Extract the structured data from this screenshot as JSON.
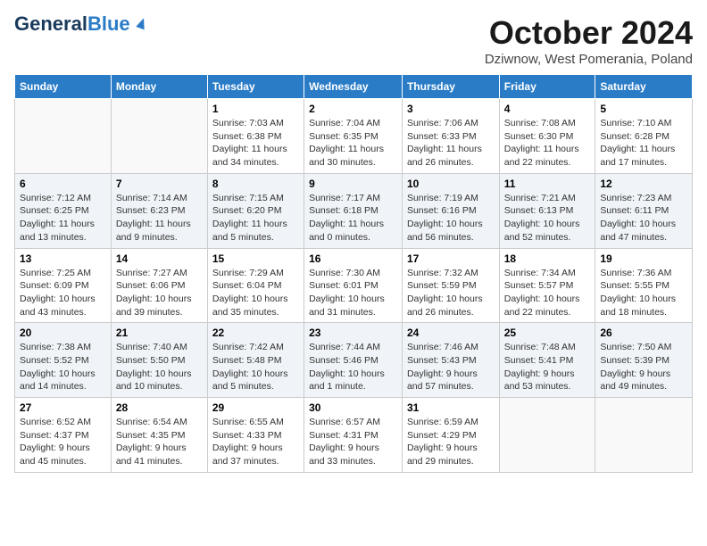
{
  "header": {
    "logo_general": "General",
    "logo_blue": "Blue",
    "month_title": "October 2024",
    "location": "Dziwnow, West Pomerania, Poland"
  },
  "days_of_week": [
    "Sunday",
    "Monday",
    "Tuesday",
    "Wednesday",
    "Thursday",
    "Friday",
    "Saturday"
  ],
  "weeks": [
    [
      {
        "day": "",
        "sunrise": "",
        "sunset": "",
        "daylight": ""
      },
      {
        "day": "",
        "sunrise": "",
        "sunset": "",
        "daylight": ""
      },
      {
        "day": "1",
        "sunrise": "Sunrise: 7:03 AM",
        "sunset": "Sunset: 6:38 PM",
        "daylight": "Daylight: 11 hours and 34 minutes."
      },
      {
        "day": "2",
        "sunrise": "Sunrise: 7:04 AM",
        "sunset": "Sunset: 6:35 PM",
        "daylight": "Daylight: 11 hours and 30 minutes."
      },
      {
        "day": "3",
        "sunrise": "Sunrise: 7:06 AM",
        "sunset": "Sunset: 6:33 PM",
        "daylight": "Daylight: 11 hours and 26 minutes."
      },
      {
        "day": "4",
        "sunrise": "Sunrise: 7:08 AM",
        "sunset": "Sunset: 6:30 PM",
        "daylight": "Daylight: 11 hours and 22 minutes."
      },
      {
        "day": "5",
        "sunrise": "Sunrise: 7:10 AM",
        "sunset": "Sunset: 6:28 PM",
        "daylight": "Daylight: 11 hours and 17 minutes."
      }
    ],
    [
      {
        "day": "6",
        "sunrise": "Sunrise: 7:12 AM",
        "sunset": "Sunset: 6:25 PM",
        "daylight": "Daylight: 11 hours and 13 minutes."
      },
      {
        "day": "7",
        "sunrise": "Sunrise: 7:14 AM",
        "sunset": "Sunset: 6:23 PM",
        "daylight": "Daylight: 11 hours and 9 minutes."
      },
      {
        "day": "8",
        "sunrise": "Sunrise: 7:15 AM",
        "sunset": "Sunset: 6:20 PM",
        "daylight": "Daylight: 11 hours and 5 minutes."
      },
      {
        "day": "9",
        "sunrise": "Sunrise: 7:17 AM",
        "sunset": "Sunset: 6:18 PM",
        "daylight": "Daylight: 11 hours and 0 minutes."
      },
      {
        "day": "10",
        "sunrise": "Sunrise: 7:19 AM",
        "sunset": "Sunset: 6:16 PM",
        "daylight": "Daylight: 10 hours and 56 minutes."
      },
      {
        "day": "11",
        "sunrise": "Sunrise: 7:21 AM",
        "sunset": "Sunset: 6:13 PM",
        "daylight": "Daylight: 10 hours and 52 minutes."
      },
      {
        "day": "12",
        "sunrise": "Sunrise: 7:23 AM",
        "sunset": "Sunset: 6:11 PM",
        "daylight": "Daylight: 10 hours and 47 minutes."
      }
    ],
    [
      {
        "day": "13",
        "sunrise": "Sunrise: 7:25 AM",
        "sunset": "Sunset: 6:09 PM",
        "daylight": "Daylight: 10 hours and 43 minutes."
      },
      {
        "day": "14",
        "sunrise": "Sunrise: 7:27 AM",
        "sunset": "Sunset: 6:06 PM",
        "daylight": "Daylight: 10 hours and 39 minutes."
      },
      {
        "day": "15",
        "sunrise": "Sunrise: 7:29 AM",
        "sunset": "Sunset: 6:04 PM",
        "daylight": "Daylight: 10 hours and 35 minutes."
      },
      {
        "day": "16",
        "sunrise": "Sunrise: 7:30 AM",
        "sunset": "Sunset: 6:01 PM",
        "daylight": "Daylight: 10 hours and 31 minutes."
      },
      {
        "day": "17",
        "sunrise": "Sunrise: 7:32 AM",
        "sunset": "Sunset: 5:59 PM",
        "daylight": "Daylight: 10 hours and 26 minutes."
      },
      {
        "day": "18",
        "sunrise": "Sunrise: 7:34 AM",
        "sunset": "Sunset: 5:57 PM",
        "daylight": "Daylight: 10 hours and 22 minutes."
      },
      {
        "day": "19",
        "sunrise": "Sunrise: 7:36 AM",
        "sunset": "Sunset: 5:55 PM",
        "daylight": "Daylight: 10 hours and 18 minutes."
      }
    ],
    [
      {
        "day": "20",
        "sunrise": "Sunrise: 7:38 AM",
        "sunset": "Sunset: 5:52 PM",
        "daylight": "Daylight: 10 hours and 14 minutes."
      },
      {
        "day": "21",
        "sunrise": "Sunrise: 7:40 AM",
        "sunset": "Sunset: 5:50 PM",
        "daylight": "Daylight: 10 hours and 10 minutes."
      },
      {
        "day": "22",
        "sunrise": "Sunrise: 7:42 AM",
        "sunset": "Sunset: 5:48 PM",
        "daylight": "Daylight: 10 hours and 5 minutes."
      },
      {
        "day": "23",
        "sunrise": "Sunrise: 7:44 AM",
        "sunset": "Sunset: 5:46 PM",
        "daylight": "Daylight: 10 hours and 1 minute."
      },
      {
        "day": "24",
        "sunrise": "Sunrise: 7:46 AM",
        "sunset": "Sunset: 5:43 PM",
        "daylight": "Daylight: 9 hours and 57 minutes."
      },
      {
        "day": "25",
        "sunrise": "Sunrise: 7:48 AM",
        "sunset": "Sunset: 5:41 PM",
        "daylight": "Daylight: 9 hours and 53 minutes."
      },
      {
        "day": "26",
        "sunrise": "Sunrise: 7:50 AM",
        "sunset": "Sunset: 5:39 PM",
        "daylight": "Daylight: 9 hours and 49 minutes."
      }
    ],
    [
      {
        "day": "27",
        "sunrise": "Sunrise: 6:52 AM",
        "sunset": "Sunset: 4:37 PM",
        "daylight": "Daylight: 9 hours and 45 minutes."
      },
      {
        "day": "28",
        "sunrise": "Sunrise: 6:54 AM",
        "sunset": "Sunset: 4:35 PM",
        "daylight": "Daylight: 9 hours and 41 minutes."
      },
      {
        "day": "29",
        "sunrise": "Sunrise: 6:55 AM",
        "sunset": "Sunset: 4:33 PM",
        "daylight": "Daylight: 9 hours and 37 minutes."
      },
      {
        "day": "30",
        "sunrise": "Sunrise: 6:57 AM",
        "sunset": "Sunset: 4:31 PM",
        "daylight": "Daylight: 9 hours and 33 minutes."
      },
      {
        "day": "31",
        "sunrise": "Sunrise: 6:59 AM",
        "sunset": "Sunset: 4:29 PM",
        "daylight": "Daylight: 9 hours and 29 minutes."
      },
      {
        "day": "",
        "sunrise": "",
        "sunset": "",
        "daylight": ""
      },
      {
        "day": "",
        "sunrise": "",
        "sunset": "",
        "daylight": ""
      }
    ]
  ]
}
